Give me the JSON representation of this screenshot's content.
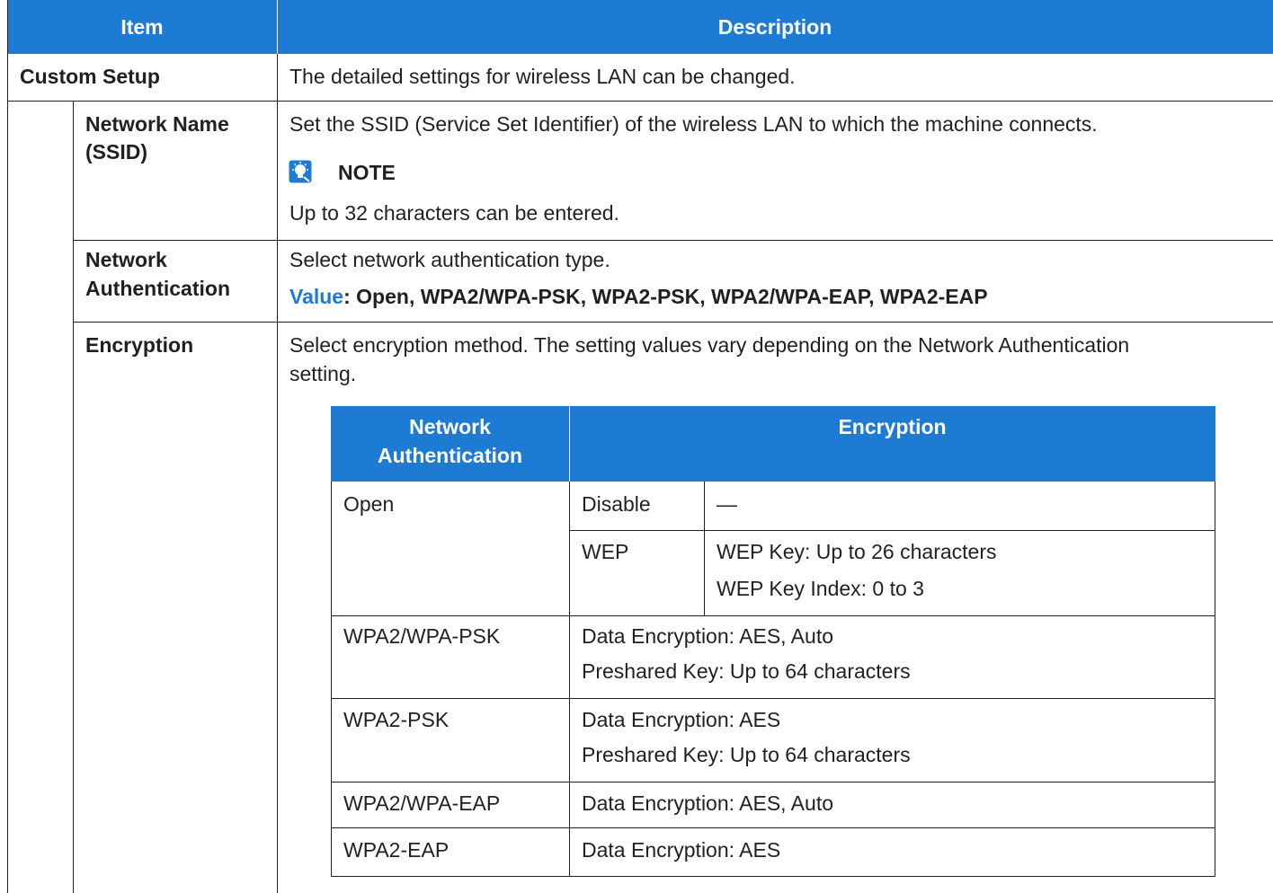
{
  "header": {
    "item": "Item",
    "description": "Description"
  },
  "custom_setup": {
    "label": "Custom Setup",
    "description": "The detailed settings for wireless LAN can be changed."
  },
  "ssid": {
    "label_line1": "Network Name",
    "label_line2": "(SSID)",
    "description": "Set the SSID (Service Set Identifier) of the wireless LAN to which the machine connects.",
    "note_title": "NOTE",
    "note_text": "Up to 32 characters can be entered."
  },
  "auth": {
    "label_line1": "Network",
    "label_line2": "Authentication",
    "description": "Select network authentication type.",
    "value_label": "Value",
    "value_text": ": Open, WPA2/WPA-PSK, WPA2-PSK, WPA2/WPA-EAP, WPA2-EAP"
  },
  "encryption": {
    "label": "Encryption",
    "description_line1": "Select encryption method. The setting values vary depending on the Network Authentication",
    "description_line2": "setting."
  },
  "inner_table": {
    "header_auth_line1": "Network",
    "header_auth_line2": "Authentication",
    "header_enc": "Encryption",
    "open": {
      "auth": "Open",
      "disable": "Disable",
      "disable_value": "—",
      "wep": "WEP",
      "wep_line1": "WEP Key: Up to 26 characters",
      "wep_line2": "WEP Key Index: 0 to 3"
    },
    "wpa2_wpa_psk": {
      "auth": "WPA2/WPA-PSK",
      "line1": "Data Encryption: AES, Auto",
      "line2": "Preshared Key: Up to 64 characters"
    },
    "wpa2_psk": {
      "auth": "WPA2-PSK",
      "line1": "Data Encryption: AES",
      "line2": "Preshared Key: Up to 64 characters"
    },
    "wpa2_wpa_eap": {
      "auth": "WPA2/WPA-EAP",
      "line1": "Data Encryption: AES, Auto"
    },
    "wpa2_eap": {
      "auth": "WPA2-EAP",
      "line1": "Data Encryption: AES"
    }
  }
}
